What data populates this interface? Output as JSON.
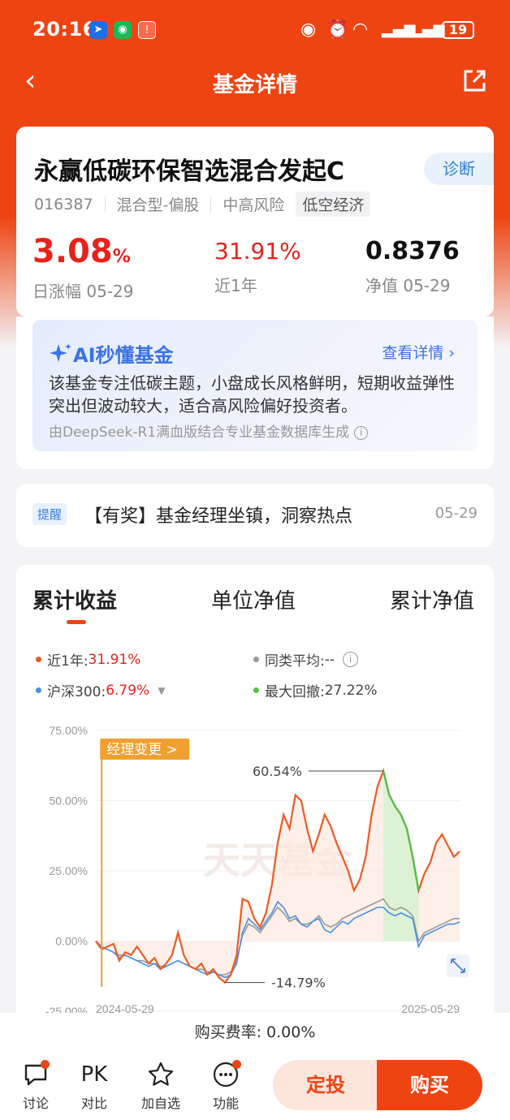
{
  "status": {
    "time": "20:16",
    "battery": "19"
  },
  "nav": {
    "title": "基金详情"
  },
  "fund": {
    "name": "永赢低碳环保智选混合发起C",
    "diagnose": "诊断",
    "code": "016387",
    "type": "混合型-偏股",
    "risk": "中高风险",
    "theme": "低空经济",
    "daily_change": "3.08",
    "daily_change_unit": "%",
    "daily_change_label": "日涨幅 05-29",
    "year_return": "31.91%",
    "year_return_label": "近1年",
    "nav_value": "0.8376",
    "nav_label": "净值 05-29"
  },
  "ai": {
    "title": "AI秒懂基金",
    "more": "查看详情",
    "text": "该基金专注低碳主题，小盘成长风格鲜明，短期收益弹性突出但波动较大，适合高风险偏好投资者。",
    "source": "由DeepSeek-R1满血版结合专业基金数据库生成"
  },
  "reminder": {
    "badge": "提醒",
    "text": "【有奖】基金经理坐镇，洞察热点",
    "date": "05-29"
  },
  "chart_tabs": [
    "累计收益",
    "单位净值",
    "累计净值"
  ],
  "legend": {
    "fund_label": "近1年:",
    "fund_value": "31.91%",
    "peer_label": "同类平均:",
    "peer_value": "--",
    "index_label": "沪深300:",
    "index_value": "6.79%",
    "drawdown_label": "最大回撤:",
    "drawdown_value": "27.22%"
  },
  "colors": {
    "accent": "#ee4412",
    "fund": "#ee5a24",
    "index": "#4a90e2",
    "peer": "#999999",
    "drawdown": "#5bbd4a"
  },
  "chart_data": {
    "type": "line",
    "y_ticks": [
      "75.00%",
      "50.00%",
      "25.00%",
      "0.00%",
      "-25.00%"
    ],
    "ylim": [
      -25,
      75
    ],
    "x_ticks": [
      "2024-05-29",
      "2025-05-29"
    ],
    "annotations": {
      "manager_change": "经理变更 >",
      "max": "60.54%",
      "min": "-14.79%",
      "watermark": "天天基金"
    },
    "series": [
      {
        "name": "近1年",
        "values": [
          0,
          -3,
          -2,
          -1,
          -7,
          -4,
          -5,
          -2,
          -5,
          -8,
          -6,
          -10,
          -8,
          -5,
          3,
          -5,
          -9,
          -10,
          -8,
          -12,
          -10,
          -13,
          -14.79,
          -12,
          -5,
          15,
          14,
          8,
          5,
          10,
          20,
          35,
          45,
          40,
          52,
          50,
          40,
          32,
          38,
          45,
          41,
          35,
          30,
          25,
          18,
          22,
          30,
          45,
          55,
          60.54,
          52,
          48,
          45,
          40,
          30,
          18,
          24,
          28,
          35,
          38,
          34,
          30,
          31.91
        ]
      },
      {
        "name": "沪深300",
        "values": [
          0,
          -2,
          -3,
          -4,
          -6,
          -5,
          -6,
          -7,
          -8,
          -9,
          -8,
          -10,
          -9,
          -8,
          -7,
          -8,
          -9,
          -10,
          -11,
          -12,
          -11,
          -12,
          -13,
          -12,
          -8,
          3,
          8,
          6,
          4,
          7,
          10,
          14,
          12,
          8,
          9,
          6,
          5,
          7,
          8,
          4,
          3,
          5,
          7,
          6,
          8,
          9,
          10,
          11,
          12,
          12,
          10,
          9,
          10,
          9,
          8,
          -2,
          2,
          3,
          4,
          5,
          6,
          6,
          6.79
        ]
      },
      {
        "name": "同类平均",
        "values": [
          0,
          -2,
          -3,
          -4,
          -5,
          -5,
          -6,
          -7,
          -7,
          -8,
          -8,
          -9,
          -9,
          -8,
          -7,
          -8,
          -9,
          -10,
          -10,
          -11,
          -11,
          -12,
          -12,
          -11,
          -7,
          2,
          6,
          5,
          3,
          6,
          9,
          12,
          10,
          7,
          8,
          6,
          6,
          7,
          9,
          6,
          5,
          6,
          8,
          9,
          10,
          11,
          12,
          13,
          14,
          15,
          12,
          11,
          12,
          11,
          9,
          0,
          3,
          4,
          5,
          6,
          7,
          8,
          8
        ]
      }
    ]
  },
  "fee": {
    "label": "购买费率: 0.00%"
  },
  "bottom": {
    "discuss": "讨论",
    "pk_icon": "PK",
    "compare": "对比",
    "watch": "加自选",
    "functions": "功能",
    "dingtou": "定投",
    "buy": "购买"
  }
}
